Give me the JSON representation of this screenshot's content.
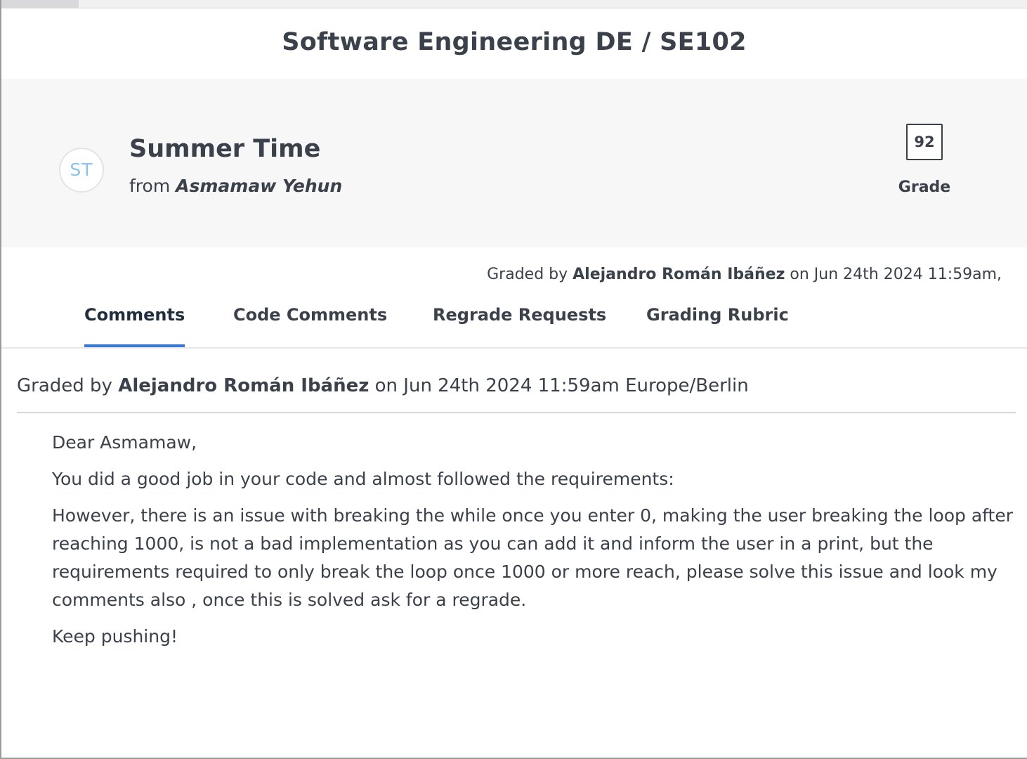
{
  "course": {
    "title": "Software Engineering DE / SE102"
  },
  "submission": {
    "avatar_initials": "ST",
    "title": "Summer Time",
    "from_prefix": "from",
    "author": "Asmamaw Yehun",
    "grade_value": "92",
    "grade_label": "Grade"
  },
  "graded_summary": {
    "prefix": "Graded by",
    "grader": "Alejandro Román Ibáñez",
    "suffix": "on Jun 24th 2024 11:59am,"
  },
  "tabs": [
    {
      "label": "Comments",
      "active": true
    },
    {
      "label": "Code Comments",
      "active": false
    },
    {
      "label": "Regrade Requests",
      "active": false
    },
    {
      "label": "Grading Rubric",
      "active": false
    }
  ],
  "comment": {
    "meta_prefix": "Graded by",
    "grader": "Alejandro Román Ibáñez",
    "meta_suffix": "on Jun 24th 2024 11:59am Europe/Berlin",
    "paragraphs": [
      "Dear Asmamaw,",
      "You did a good job in your code and almost followed the requirements:",
      "However, there is an issue with breaking the while once you enter 0, making the user breaking the loop after reaching 1000, is not a bad implementation as you can add it and inform the user in a print, but the requirements required to only break the loop once 1000 or more reach, please solve this issue and look my comments also , once this is solved ask for a regrade.",
      "Keep pushing!"
    ]
  },
  "colors": {
    "text": "#3b414b",
    "panel_bg": "#f7f7f8",
    "active_tab_underline": "#3a78d8",
    "avatar_text": "#8cc3ec"
  }
}
